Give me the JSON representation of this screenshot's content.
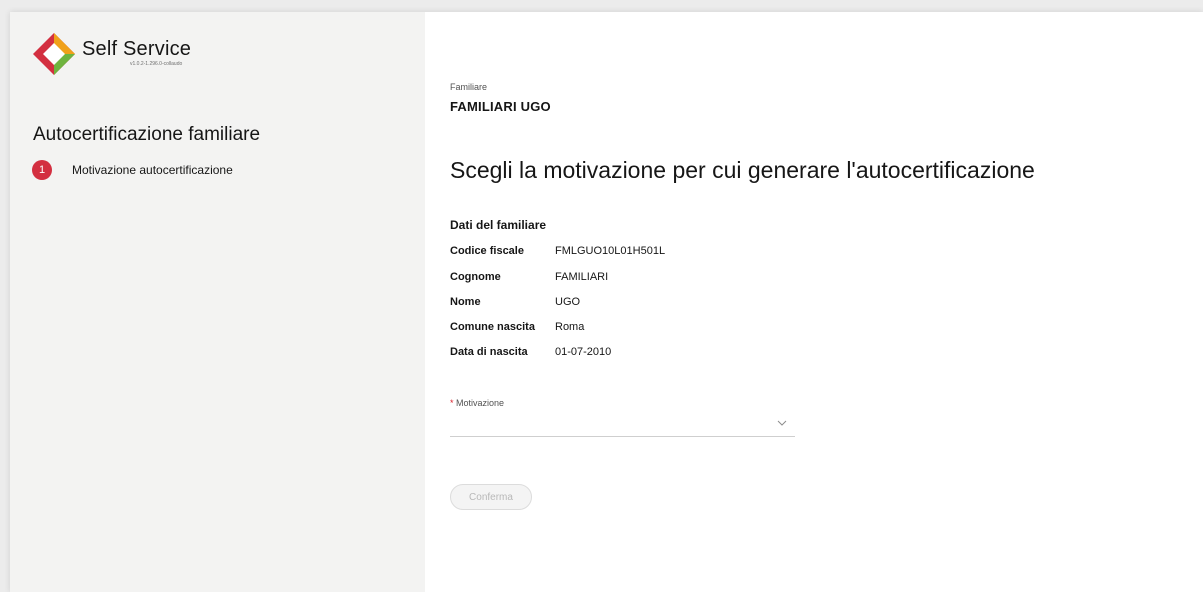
{
  "app": {
    "name": "Self Service",
    "version": "v1.0.2-1.296.0-collaudo"
  },
  "sidebar": {
    "title": "Autocertificazione familiare",
    "steps": [
      {
        "number": "1",
        "label": "Motivazione autocertificazione"
      }
    ]
  },
  "main": {
    "familiare_label": "Familiare",
    "familiare_name": "FAMILIARI UGO",
    "heading": "Scegli la motivazione per cui generare l'autocertificazione",
    "section_title": "Dati del familiare",
    "fields": [
      {
        "label": "Codice fiscale",
        "value": "FMLGUO10L01H501L"
      },
      {
        "label": "Cognome",
        "value": "FAMILIARI"
      },
      {
        "label": "Nome",
        "value": "UGO"
      },
      {
        "label": "Comune nascita",
        "value": "Roma"
      },
      {
        "label": "Data di nascita",
        "value": "01-07-2010"
      }
    ],
    "motivazione": {
      "required_mark": "*",
      "label": "Motivazione",
      "value": ""
    },
    "confirm_label": "Conferma"
  },
  "colors": {
    "accent_red": "#d32f40",
    "sidebar_bg": "#f3f3f2",
    "logo_green": "#6fb43f",
    "logo_orange": "#f0a11a"
  },
  "icons": {
    "logo": "self-service-logo",
    "select_arrow": "chevron-down-icon"
  }
}
